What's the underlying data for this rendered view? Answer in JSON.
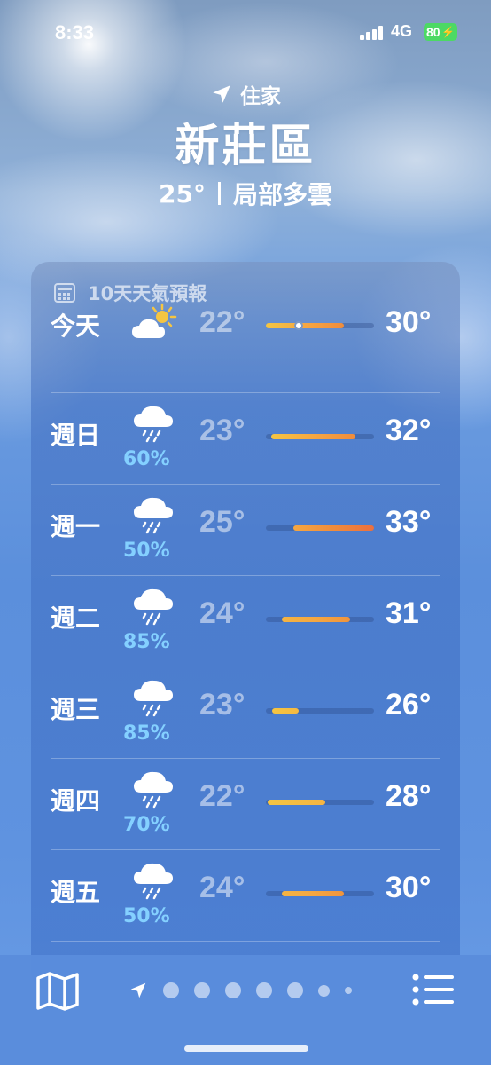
{
  "status_bar": {
    "time": "8:33",
    "network": "4G",
    "battery": "80"
  },
  "header": {
    "location_label": "住家",
    "city": "新莊區",
    "current_temp": "25°",
    "condition": "局部多雲"
  },
  "forecast": {
    "title": "10天天氣預報",
    "days": [
      {
        "day": "今天",
        "icon": "partly-cloudy-icon",
        "precip": "",
        "low": "22°",
        "high": "30°",
        "bar_start": 0.0,
        "bar_end": 0.72,
        "now_pos": 0.3,
        "bar_colors": [
          "#f5c542",
          "#f5a742",
          "#f08c3c"
        ]
      },
      {
        "day": "週日",
        "icon": "rain-icon",
        "precip": "60%",
        "low": "23°",
        "high": "32°",
        "bar_start": 0.05,
        "bar_end": 0.83,
        "bar_colors": [
          "#f5c542",
          "#f5a742",
          "#f08c3c"
        ]
      },
      {
        "day": "週一",
        "icon": "rain-icon",
        "precip": "50%",
        "low": "25°",
        "high": "33°",
        "bar_start": 0.25,
        "bar_end": 1.0,
        "bar_colors": [
          "#f5a742",
          "#f08c3c",
          "#eb7040"
        ]
      },
      {
        "day": "週二",
        "icon": "rain-icon",
        "precip": "85%",
        "low": "24°",
        "high": "31°",
        "bar_start": 0.15,
        "bar_end": 0.78,
        "bar_colors": [
          "#f5b442",
          "#f5a742",
          "#f0943c"
        ]
      },
      {
        "day": "週三",
        "icon": "rain-icon",
        "precip": "85%",
        "low": "23°",
        "high": "26°",
        "bar_start": 0.06,
        "bar_end": 0.3,
        "bar_colors": [
          "#f5c542",
          "#f5b942"
        ]
      },
      {
        "day": "週四",
        "icon": "rain-icon",
        "precip": "70%",
        "low": "22°",
        "high": "28°",
        "bar_start": 0.02,
        "bar_end": 0.55,
        "bar_colors": [
          "#f5c542",
          "#f5b442"
        ]
      },
      {
        "day": "週五",
        "icon": "rain-icon",
        "precip": "50%",
        "low": "24°",
        "high": "30°",
        "bar_start": 0.15,
        "bar_end": 0.72,
        "bar_colors": [
          "#f5b442",
          "#f5a742",
          "#f0943c"
        ]
      }
    ]
  }
}
